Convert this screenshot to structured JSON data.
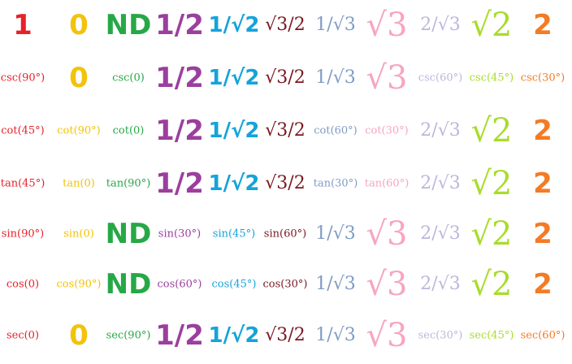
{
  "colors": {
    "col0": "#e8202a",
    "col1": "#f2c30a",
    "col2": "#26a846",
    "col3": "#9b3f9e",
    "col4": "#15a3da",
    "col5": "#7a1720",
    "col6": "#7f9cc4",
    "col7": "#f7a6bf",
    "col8": "#bdb6dc",
    "col9": "#a9dc2c",
    "col10": "#f47b25"
  },
  "rows": [
    [
      "1",
      "0",
      "ND",
      "1/2",
      "1/√2",
      "√3/2",
      "1/√3",
      "√3",
      "2/√3",
      "√2",
      "2"
    ],
    [
      "csc(90°)",
      "0",
      "csc(0)",
      "1/2",
      "1/√2",
      "√3/2",
      "1/√3",
      "√3",
      "csc(60°)",
      "csc(45°)",
      "csc(30°)"
    ],
    [
      "cot(45°)",
      "cot(90°)",
      "cot(0)",
      "1/2",
      "1/√2",
      "√3/2",
      "cot(60°)",
      "cot(30°)",
      "2/√3",
      "√2",
      "2"
    ],
    [
      "tan(45°)",
      "tan(0)",
      "tan(90°)",
      "1/2",
      "1/√2",
      "√3/2",
      "tan(30°)",
      "tan(60°)",
      "2/√3",
      "√2",
      "2"
    ],
    [
      "sin(90°)",
      "sin(0)",
      "ND",
      "sin(30°)",
      "sin(45°)",
      "sin(60°)",
      "1/√3",
      "√3",
      "2/√3",
      "√2",
      "2"
    ],
    [
      "cos(0)",
      "cos(90°)",
      "ND",
      "cos(60°)",
      "cos(45°)",
      "cos(30°)",
      "1/√3",
      "√3",
      "2/√3",
      "√2",
      "2"
    ],
    [
      "sec(0)",
      "0",
      "sec(90°)",
      "1/2",
      "1/√2",
      "√3/2",
      "1/√3",
      "√3",
      "sec(30°)",
      "sec(45°)",
      "sec(60°)"
    ]
  ]
}
